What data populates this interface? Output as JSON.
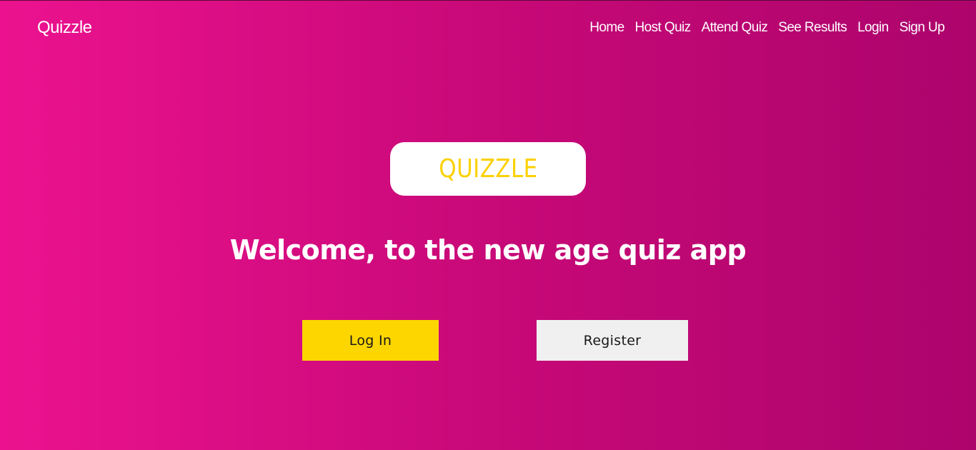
{
  "header": {
    "brand": "Quizzle",
    "nav": [
      {
        "label": "Home"
      },
      {
        "label": "Host Quiz"
      },
      {
        "label": "Attend Quiz"
      },
      {
        "label": "See Results"
      },
      {
        "label": "Login"
      },
      {
        "label": "Sign Up"
      }
    ]
  },
  "hero": {
    "logo_text": "QUIZZLE",
    "welcome": "Welcome, to the new age quiz app",
    "login_button": "Log In",
    "register_button": "Register"
  },
  "colors": {
    "background_start": "#ec128f",
    "background_end": "#ad046c",
    "accent_yellow": "#fdd600",
    "logo_text": "#fbd100",
    "register_bg": "#f0f0f0"
  }
}
